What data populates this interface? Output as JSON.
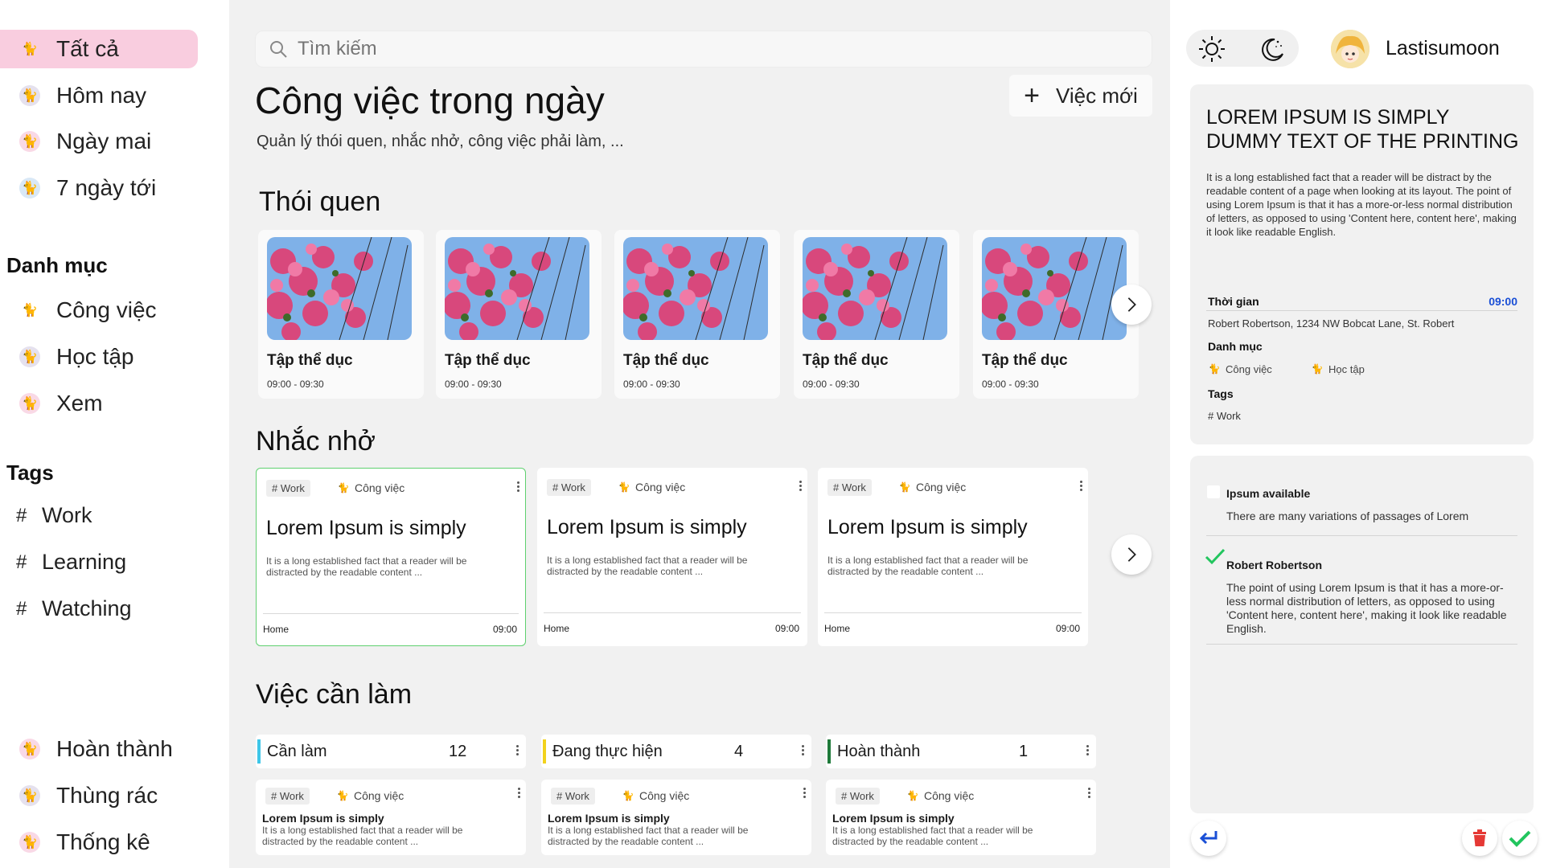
{
  "sidebar": {
    "nav": [
      {
        "label": "Tất cả",
        "icon": "cat-icon"
      },
      {
        "label": "Hôm nay",
        "icon": "cat-icon"
      },
      {
        "label": "Ngày mai",
        "icon": "cat-icon"
      },
      {
        "label": "7 ngày tới",
        "icon": "cat-icon"
      }
    ],
    "categories_title": "Danh mục",
    "categories": [
      {
        "label": "Công việc",
        "icon": "cat-icon"
      },
      {
        "label": "Học tập",
        "icon": "cat-icon"
      },
      {
        "label": "Xem",
        "icon": "cat-icon"
      }
    ],
    "tags_title": "Tags",
    "tags": [
      {
        "hash": "#",
        "label": "Work"
      },
      {
        "hash": "#",
        "label": "Learning"
      },
      {
        "hash": "#",
        "label": "Watching"
      }
    ],
    "bottom": [
      {
        "label": "Hoàn thành",
        "icon": "cat-icon"
      },
      {
        "label": "Thùng rác",
        "icon": "cat-icon"
      },
      {
        "label": "Thống kê",
        "icon": "cat-icon"
      }
    ]
  },
  "main": {
    "search_placeholder": "Tìm kiếm",
    "title": "Công việc trong ngày",
    "subtitle": "Quản lý thói quen, nhắc nhở, công việc phải làm, ...",
    "new_button": "Việc mới",
    "habits_title": "Thói quen",
    "habits": [
      {
        "title": "Tập thể dục",
        "time": "09:00 - 09:30"
      },
      {
        "title": "Tập thể dục",
        "time": "09:00 - 09:30"
      },
      {
        "title": "Tập thể dục",
        "time": "09:00 - 09:30"
      },
      {
        "title": "Tập thể dục",
        "time": "09:00 - 09:30"
      },
      {
        "title": "Tập thể dục",
        "time": "09:00 - 09:30"
      }
    ],
    "reminders_title": "Nhắc nhở",
    "reminders": [
      {
        "tag": "# Work",
        "category": "Công việc",
        "title": "Lorem Ipsum is simply",
        "desc": "It is a long established fact that a reader will be distracted by the readable content ...",
        "place": "Home",
        "time": "09:00"
      },
      {
        "tag": "# Work",
        "category": "Công việc",
        "title": "Lorem Ipsum is simply",
        "desc": "It is a long established fact that a reader will be distracted by the readable content ...",
        "place": "Home",
        "time": "09:00"
      },
      {
        "tag": "# Work",
        "category": "Công việc",
        "title": "Lorem Ipsum is simply",
        "desc": "It is a long established fact that a reader will be distracted by the readable content ...",
        "place": "Home",
        "time": "09:00"
      }
    ],
    "todo_title": "Việc cần làm",
    "columns": [
      {
        "label": "Cần làm",
        "count": "12",
        "color": "#3ec6e8",
        "task": {
          "tag": "# Work",
          "category": "Công việc",
          "title": "Lorem Ipsum is simply",
          "desc": "It is a long established fact that a reader will be distracted by the readable content ..."
        }
      },
      {
        "label": "Đang thực hiện",
        "count": "4",
        "color": "#f2d21c",
        "task": {
          "tag": "# Work",
          "category": "Công việc",
          "title": "Lorem Ipsum is simply",
          "desc": "It is a long established fact that a reader will be distracted by the readable content ..."
        }
      },
      {
        "label": "Hoàn thành",
        "count": "1",
        "color": "#1f7a3a",
        "task": {
          "tag": "# Work",
          "category": "Công việc",
          "title": "Lorem Ipsum is simply",
          "desc": "It is a long established fact that a reader will be distracted by the readable content ..."
        }
      }
    ]
  },
  "right": {
    "username": "Lastisumoon",
    "detail": {
      "title": "LOREM IPSUM IS SIMPLY DUMMY TEXT OF THE PRINTING",
      "body": "It is a long established fact that a reader will be distract by the readable content of a page when looking at its layout. The point of using Lorem Ipsum is that it has a more-or-less normal distribution of letters, as opposed to using 'Content here, content here', making it look like readable English.",
      "time_label": "Thời gian",
      "time_value": "09:00",
      "address": "Robert Robertson, 1234 NW Bobcat Lane, St. Robert",
      "category_label": "Danh mục",
      "categories": [
        "Công việc",
        "Học tập"
      ],
      "tags_label": "Tags",
      "tag": "# Work"
    },
    "checklist": [
      {
        "title": "Ipsum available",
        "desc": "There are many variations of passages of Lorem",
        "checked": false
      },
      {
        "title": "Robert Robertson",
        "desc": "The point of using Lorem Ipsum is that it has a more-or-less normal distribution of letters, as opposed to using 'Content here, content here', making it look like readable English.",
        "checked": true
      }
    ]
  },
  "colors": {
    "active_nav": "#f9cddf",
    "accent_blue": "#1a4fd6",
    "check_green": "#22c55e",
    "delete_red": "#e53935"
  }
}
